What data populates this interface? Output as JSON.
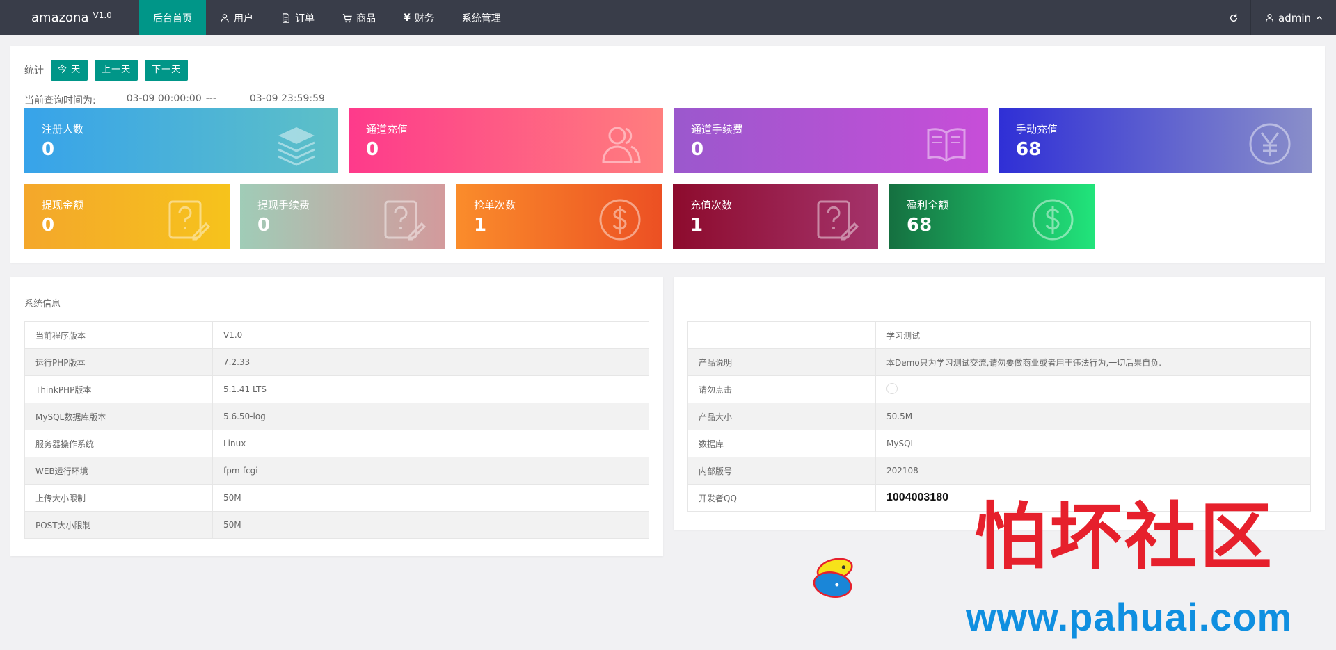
{
  "app": {
    "name": "amazona",
    "version": "V1.0"
  },
  "nav": [
    {
      "label": "后台首页",
      "icon": ""
    },
    {
      "label": "用户",
      "icon": "user-icon"
    },
    {
      "label": "订单",
      "icon": "document-icon"
    },
    {
      "label": "商品",
      "icon": "cart-icon"
    },
    {
      "label": "财务",
      "icon": "yen-icon"
    },
    {
      "label": "系统管理",
      "icon": ""
    }
  ],
  "header": {
    "user_label": "admin"
  },
  "stats": {
    "label": "统计",
    "buttons": {
      "today": "今 天",
      "prev": "上一天",
      "next": "下一天"
    },
    "query_label": "当前查询时间为:",
    "time_start": "03-09 00:00:00",
    "time_sep": "---",
    "time_end": "03-09 23:59:59",
    "cards": [
      {
        "label": "注册人数",
        "value": "0",
        "icon": "layers-icon"
      },
      {
        "label": "通道充值",
        "value": "0",
        "icon": "users-icon"
      },
      {
        "label": "通道手续费",
        "value": "0",
        "icon": "book-icon"
      },
      {
        "label": "手动充值",
        "value": "68",
        "icon": "yen-circle-icon"
      },
      {
        "label": "提现金额",
        "value": "0",
        "icon": "question-edit-icon"
      },
      {
        "label": "提现手续费",
        "value": "0",
        "icon": "question-edit-icon"
      },
      {
        "label": "抢单次数",
        "value": "1",
        "icon": "dollar-circle-icon"
      },
      {
        "label": "充值次数",
        "value": "1",
        "icon": "question-edit-icon"
      },
      {
        "label": "盈利全额",
        "value": "68",
        "icon": "dollar-circle-icon"
      }
    ]
  },
  "system_info": {
    "title": "系统信息",
    "rows": [
      {
        "key": "当前程序版本",
        "value": "V1.0"
      },
      {
        "key": "运行PHP版本",
        "value": "7.2.33"
      },
      {
        "key": "ThinkPHP版本",
        "value": "5.1.41 LTS"
      },
      {
        "key": "MySQL数据库版本",
        "value": "5.6.50-log"
      },
      {
        "key": "服务器操作系统",
        "value": "Linux"
      },
      {
        "key": "WEB运行环境",
        "value": "fpm-fcgi"
      },
      {
        "key": "上传大小限制",
        "value": "50M"
      },
      {
        "key": "POST大小限制",
        "value": "50M"
      }
    ]
  },
  "product_info": {
    "rows": [
      {
        "key": "",
        "value": "学习测试"
      },
      {
        "key": "产品说明",
        "value": "本Demo只为学习测试交流,请勿要做商业或者用于违法行为,一切后果自负."
      },
      {
        "key": "请勿点击",
        "value": ""
      },
      {
        "key": "产品大小",
        "value": "50.5M"
      },
      {
        "key": "数据库",
        "value": "MySQL"
      },
      {
        "key": "内部版号",
        "value": "202108"
      },
      {
        "key": "开发者QQ",
        "value": "1004003180"
      }
    ]
  },
  "watermark": {
    "text": "怕坏社区",
    "url": "www.pahuai.com"
  }
}
